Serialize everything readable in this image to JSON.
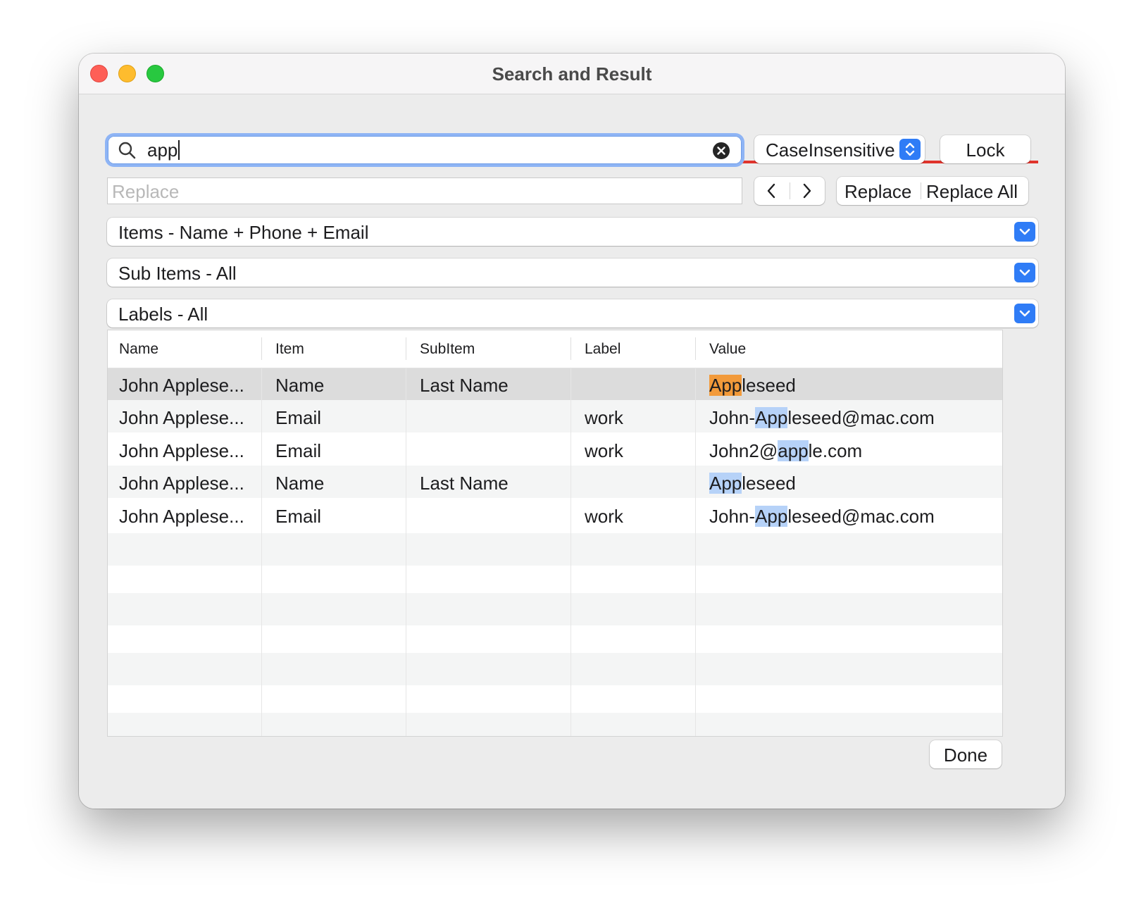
{
  "window": {
    "title": "Search and Result"
  },
  "search": {
    "value": "app"
  },
  "case_mode": {
    "selected": "CaseInsensitive"
  },
  "lock_label": "Lock",
  "replace": {
    "placeholder": "Replace",
    "value": ""
  },
  "replace_button": "Replace",
  "replace_all_button": "Replace All",
  "filters": {
    "items": "Items - Name + Phone + Email",
    "sub_items": "Sub Items - All",
    "labels": "Labels - All"
  },
  "table": {
    "columns": [
      "Name",
      "Item",
      "SubItem",
      "Label",
      "Value"
    ],
    "rows": [
      {
        "name": "John Applese...",
        "item": "Name",
        "subitem": "Last Name",
        "label": "",
        "value_pre": "",
        "value_match": "App",
        "value_post": "leseed"
      },
      {
        "name": "John Applese...",
        "item": "Email",
        "subitem": "",
        "label": "work",
        "value_pre": "John-",
        "value_match": "App",
        "value_post": "leseed@mac.com"
      },
      {
        "name": "John Applese...",
        "item": "Email",
        "subitem": "",
        "label": "work",
        "value_pre": "John2@",
        "value_match": "app",
        "value_post": "le.com"
      },
      {
        "name": "John Applese...",
        "item": "Name",
        "subitem": "Last Name",
        "label": "",
        "value_pre": "",
        "value_match": "App",
        "value_post": "leseed"
      },
      {
        "name": "John Applese...",
        "item": "Email",
        "subitem": "",
        "label": "work",
        "value_pre": "John-",
        "value_match": "App",
        "value_post": "leseed@mac.com"
      }
    ]
  },
  "done_label": "Done",
  "colors": {
    "accent": "#2f7cf6",
    "focus_ring": "#8eb4f5",
    "divider_red": "#e0332c",
    "current_match": "#f29a3a",
    "other_match": "#b6d2f8",
    "selected_row": "#dcdcdc"
  }
}
